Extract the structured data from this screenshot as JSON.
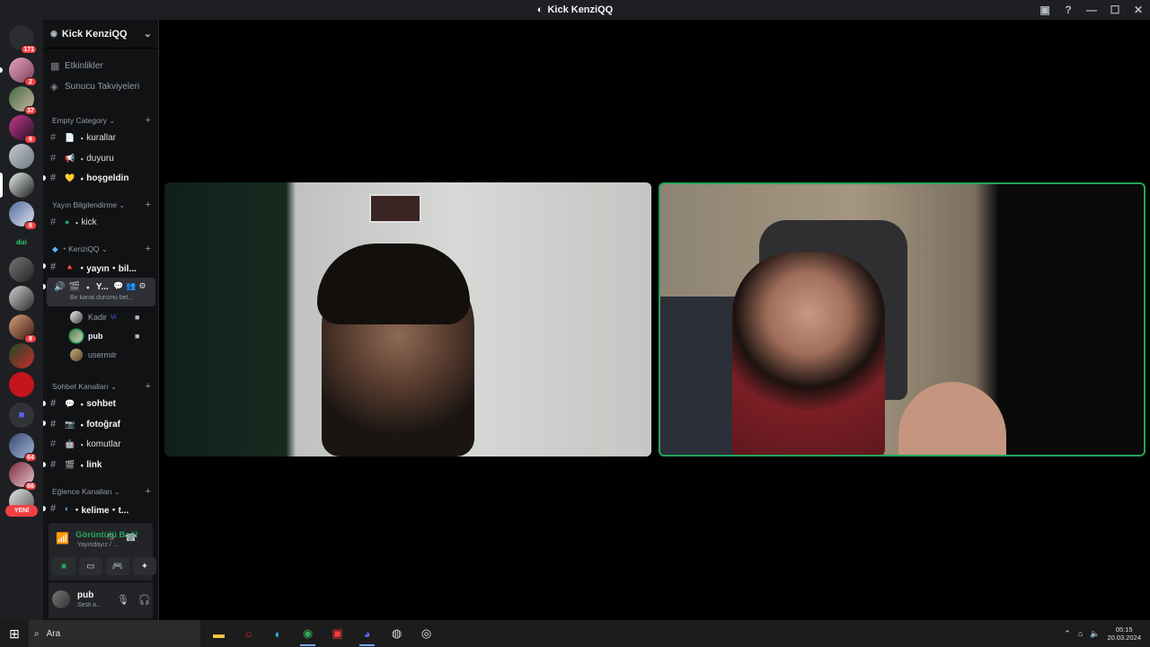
{
  "window": {
    "title": "Kick KenziQQ"
  },
  "servers": {
    "badges": [
      "171",
      "2",
      "37",
      "6",
      "8",
      "8",
      "64",
      "66"
    ],
    "new_label": "YENİ"
  },
  "guild": {
    "name": "Kick KenziQQ",
    "top_items": [
      {
        "icon": "calendar-icon",
        "label": "Etkinlikler"
      },
      {
        "icon": "boost-icon",
        "label": "Sunucu Takviyeleri"
      }
    ],
    "categories": [
      {
        "name": "Empty Category",
        "channels": [
          "kurallar",
          "duyuru",
          "hoşgeldin"
        ]
      },
      {
        "name": "Yayın Bilgilendirme",
        "channels": [
          "kick"
        ]
      },
      {
        "name": "KenziQQ",
        "channels": [
          "yayın・bil..."
        ]
      },
      {
        "name": "Sohbet Kanalları",
        "channels": [
          "sohbet",
          "fotoğraf",
          "komutlar",
          "link"
        ]
      },
      {
        "name": "Eğlence Kanalları",
        "channels": [
          "kelime・t..."
        ]
      }
    ],
    "voice_channel": {
      "name": "Y...",
      "status": "Bir kanal durumu bel...",
      "users": [
        {
          "name": "Kadir",
          "tag": "Vi"
        },
        {
          "name": "pub",
          "tag": ""
        },
        {
          "name": "usermilr",
          "tag": ""
        }
      ]
    }
  },
  "voice_panel": {
    "status": "Görüntülü Bağl",
    "sub": "Yayındayız / ..."
  },
  "user_panel": {
    "name": "pub",
    "status": "Sesli a..."
  },
  "taskbar": {
    "search_placeholder": "Ara",
    "time": "05:15",
    "date": "20.03.2024"
  },
  "colors": {
    "connected": "#23a55a",
    "badge": "#f23f43",
    "sidebar": "#1e1f22"
  }
}
